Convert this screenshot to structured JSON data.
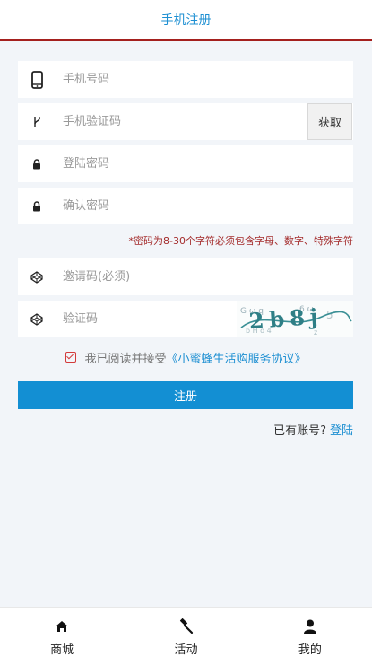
{
  "header": {
    "title": "手机注册"
  },
  "form": {
    "phone_placeholder": "手机号码",
    "sms_placeholder": "手机验证码",
    "get_code_label": "获取",
    "password_placeholder": "登陆密码",
    "confirm_placeholder": "确认密码",
    "password_hint": "*密码为8-30个字符必须包含字母、数字、特殊字符",
    "invite_placeholder": "邀请码(必须)",
    "captcha_placeholder": "验证码",
    "captcha_text": "2b8j"
  },
  "agreement": {
    "text": "我已阅读并接受",
    "link": "《小蜜蜂生活购服务协议》"
  },
  "submit_label": "注册",
  "login": {
    "question": "已有账号?",
    "link": "登陆"
  },
  "tabbar": [
    {
      "label": "商城",
      "icon": "home-icon"
    },
    {
      "label": "活动",
      "icon": "gavel-icon"
    },
    {
      "label": "我的",
      "icon": "user-icon"
    }
  ],
  "colors": {
    "accent": "#138fd3",
    "header_border": "#a4201e",
    "hint": "#a42c2c",
    "background": "#f2f5f9"
  }
}
